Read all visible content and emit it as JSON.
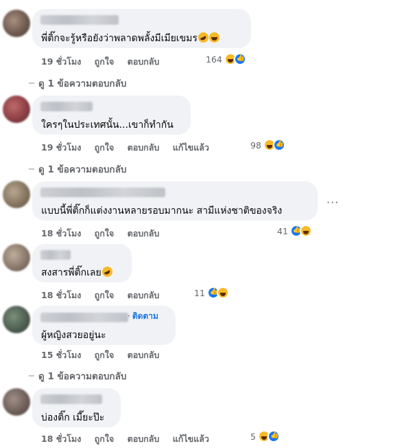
{
  "comments": [
    {
      "text": "พี่ติ๊กจะรู้หรือยังว่าพลาดพลั้งมีเมียเขมร",
      "time": "19 ชั่วโมง",
      "like_label": "ถูกใจ",
      "reply_label": "ตอบกลับ",
      "edited_label": "",
      "reaction_count": "164",
      "reactions": [
        "haha",
        "like"
      ],
      "replies_label": "ดู 1 ข้อความตอบกลับ"
    },
    {
      "text": "ใครๆในประเทศนั้น...เขาก็ทำกัน",
      "time": "19 ชั่วโมง",
      "like_label": "ถูกใจ",
      "reply_label": "ตอบกลับ",
      "edited_label": "แก้ไขแล้ว",
      "reaction_count": "98",
      "reactions": [
        "haha",
        "like"
      ],
      "replies_label": "ดู 1 ข้อความตอบกลับ"
    },
    {
      "text": "แบบนี้พี่ติ๊กก็แต่งงานหลายรอบมากนะ สามีแห่งชาติของจริง",
      "time": "18 ชั่วโมง",
      "like_label": "ถูกใจ",
      "reply_label": "ตอบกลับ",
      "edited_label": "",
      "reaction_count": "41",
      "reactions": [
        "like",
        "haha"
      ],
      "more_label": "···"
    },
    {
      "text": "สงสารพี่ติ๊กเลย",
      "time": "18 ชั่วโมง",
      "like_label": "ถูกใจ",
      "reply_label": "ตอบกลับ",
      "edited_label": "",
      "reaction_count": "11",
      "reactions": [
        "like",
        "haha"
      ]
    },
    {
      "follow_label": "ติดตาม",
      "text": "ผู้หญิงสวยอยู่นะ",
      "time": "15 ชั่วโมง",
      "like_label": "ถูกใจ",
      "reply_label": "ตอบกลับ",
      "edited_label": "",
      "reaction_count": "",
      "replies_label": "ดู 1 ข้อความตอบกลับ"
    },
    {
      "text": "บ่องติ๊ก เมี๊ยะป๊ะ",
      "time": "18 ชั่วโมง",
      "like_label": "ถูกใจ",
      "reply_label": "ตอบกลับ",
      "edited_label": "แก้ไขแล้ว",
      "reaction_count": "5",
      "reactions": [
        "haha",
        "like"
      ]
    }
  ],
  "colors": {
    "bubble": "#f0f2f5",
    "meta": "#65676b",
    "link": "#1b74e4",
    "like": "#1877f2",
    "haha": "#f7b928"
  }
}
